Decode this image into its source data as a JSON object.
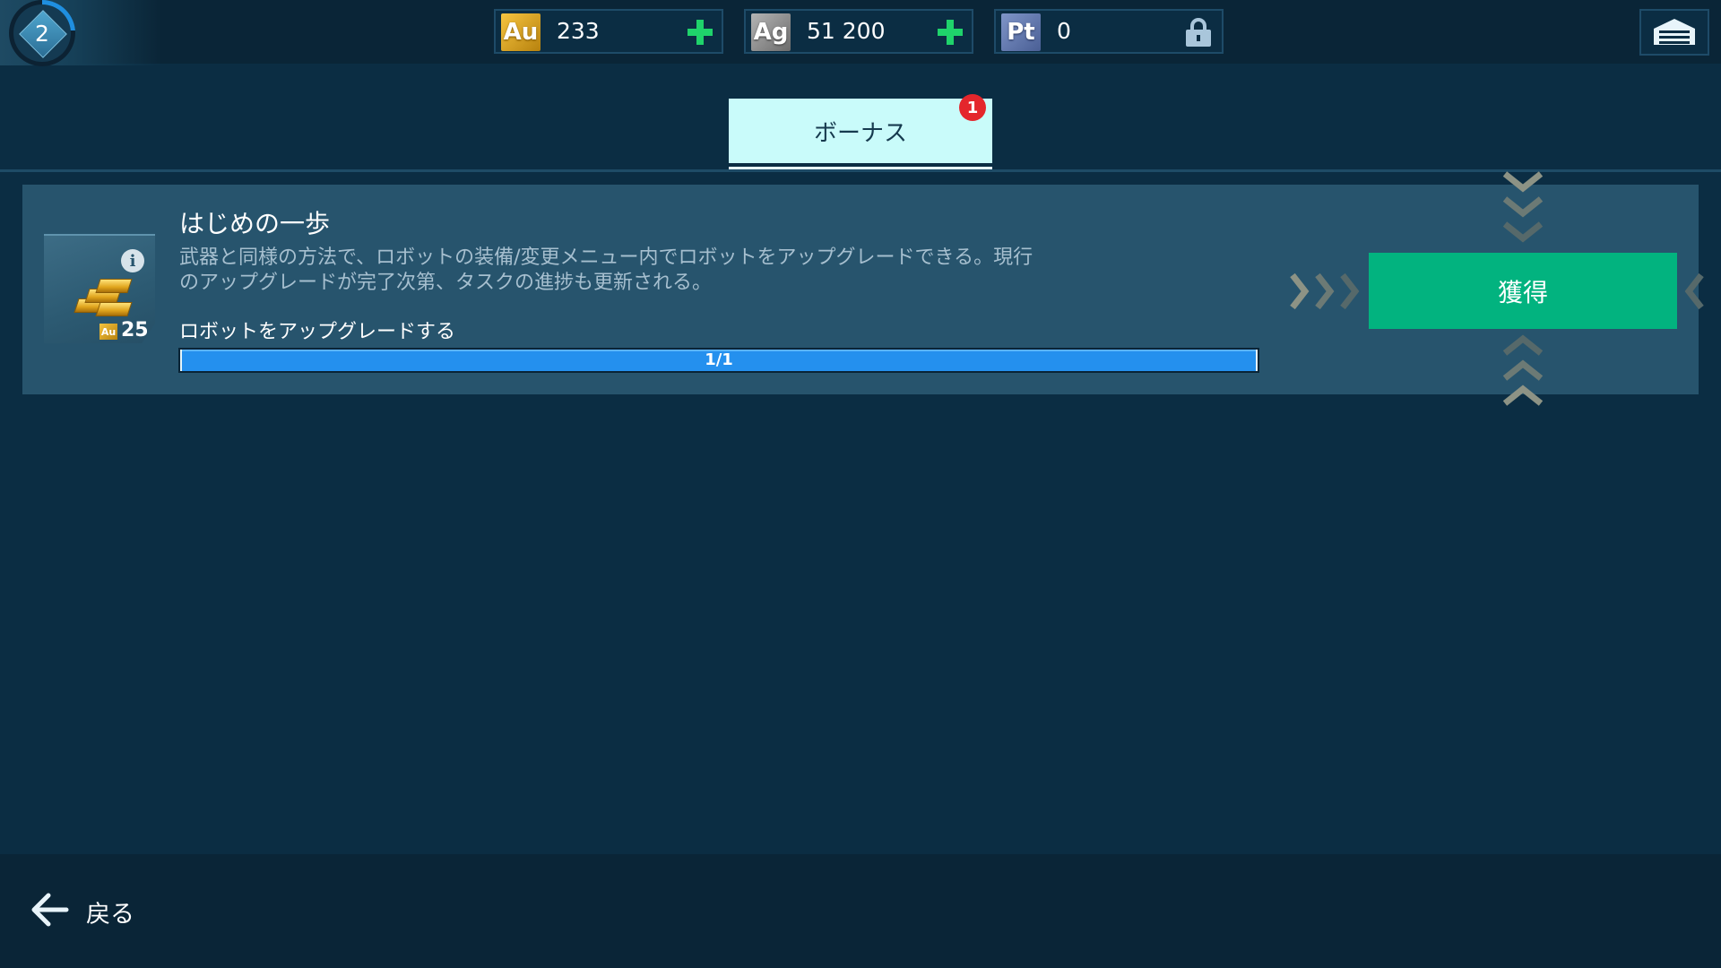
{
  "header": {
    "level": "2",
    "currencies": [
      {
        "symbol": "Au",
        "value": "233",
        "action": "plus"
      },
      {
        "symbol": "Ag",
        "value": "51 200",
        "action": "plus"
      },
      {
        "symbol": "Pt",
        "value": "0",
        "action": "locked"
      }
    ],
    "garage_icon": "garage-icon"
  },
  "tabs": [
    {
      "label": "ボーナス",
      "badge": "1",
      "active": true
    }
  ],
  "task": {
    "title": "はじめの一歩",
    "description_line1": "武器と同様の方法で、ロボットの装備/変更メニュー内でロボットをアップグレードできる。現行",
    "description_line2": "のアップグレードが完了次第、タスクの進捗も更新される。",
    "goal": "ロボットをアップグレードする",
    "progress_text": "1/1",
    "progress_fraction": 1.0,
    "reward": {
      "currency": "Au",
      "amount": "25"
    },
    "claim_label": "獲得"
  },
  "footer": {
    "back_label": "戻る"
  },
  "colors": {
    "background": "#0b2d43",
    "card": "#27546d",
    "tab_active": "#c9fbfa",
    "claim_button": "#02b37f",
    "progress": "#2490ee",
    "plus": "#1fd36b",
    "badge": "#e4262c"
  }
}
